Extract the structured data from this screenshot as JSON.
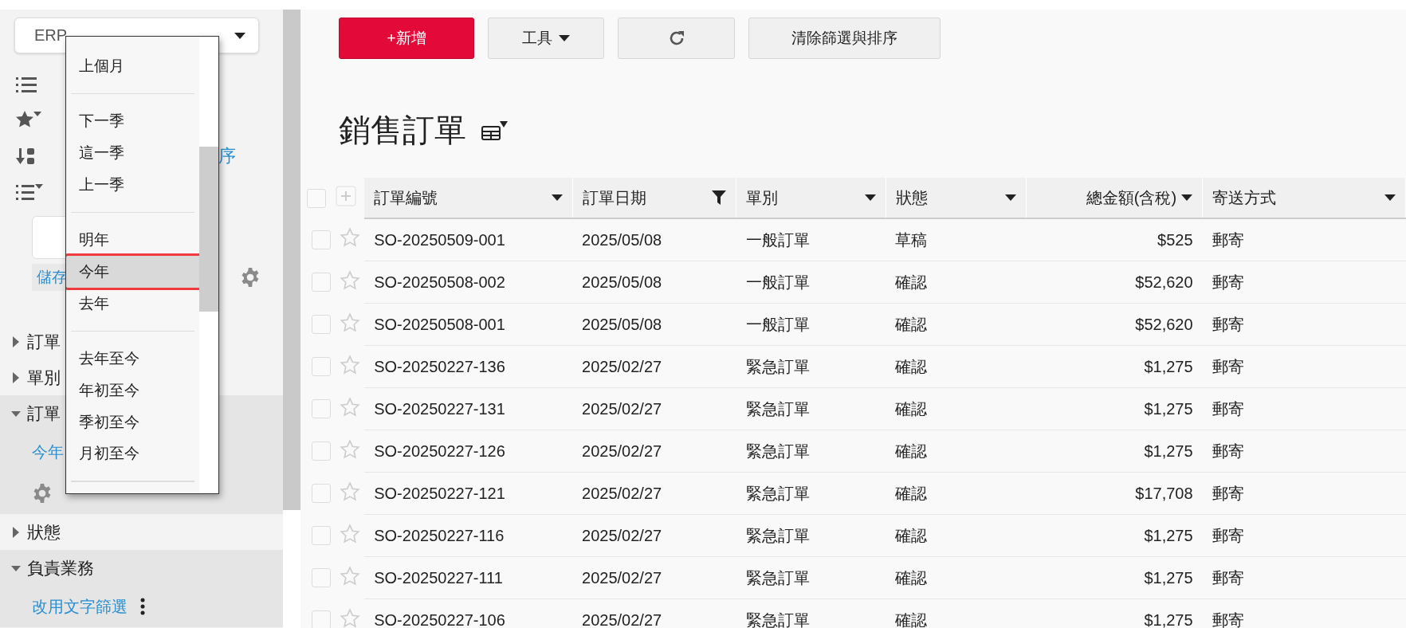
{
  "sidebar": {
    "view_select": {
      "value": "ERP"
    },
    "sort_row_text": "序",
    "save_link": "儲存",
    "sections": [
      {
        "label": "訂單",
        "expanded": false
      },
      {
        "label": "單別",
        "expanded": false
      },
      {
        "label": "訂單",
        "expanded": true,
        "children": [
          {
            "kind": "link",
            "label": "今年"
          },
          {
            "kind": "settings"
          }
        ]
      },
      {
        "label": "狀態",
        "expanded": false
      },
      {
        "label": "負責業務",
        "expanded": true,
        "children": [
          {
            "kind": "link_menu",
            "label": "改用文字篩選"
          }
        ]
      }
    ]
  },
  "dropdown": {
    "groups": [
      [
        {
          "label": "上個月",
          "selected": false
        }
      ],
      [
        {
          "label": "下一季",
          "selected": false
        },
        {
          "label": "這一季",
          "selected": false
        },
        {
          "label": "上一季",
          "selected": false
        }
      ],
      [
        {
          "label": "明年",
          "selected": false
        },
        {
          "label": "今年",
          "selected": true
        },
        {
          "label": "去年",
          "selected": false
        }
      ],
      [
        {
          "label": "去年至今",
          "selected": false
        },
        {
          "label": "年初至今",
          "selected": false
        },
        {
          "label": "季初至今",
          "selected": false
        },
        {
          "label": "月初至今",
          "selected": false
        }
      ]
    ]
  },
  "toolbar": {
    "buttons": [
      {
        "kind": "primary",
        "label": "+新增"
      },
      {
        "kind": "menu",
        "label": "工具"
      },
      {
        "kind": "refresh"
      },
      {
        "kind": "plain",
        "label": "清除篩選與排序"
      }
    ]
  },
  "title": "銷售訂單",
  "table": {
    "all_checked": false,
    "columns": [
      {
        "label": "訂單編號",
        "filtered": false,
        "kind": "text"
      },
      {
        "label": "訂單日期",
        "filtered": true,
        "kind": "text"
      },
      {
        "label": "單別",
        "filtered": false,
        "kind": "text"
      },
      {
        "label": "狀態",
        "filtered": false,
        "kind": "text"
      },
      {
        "label": "總金額(含稅)",
        "filtered": false,
        "kind": "amount"
      },
      {
        "label": "寄送方式",
        "filtered": false,
        "kind": "text"
      }
    ],
    "rows": [
      {
        "checked": false,
        "starred": false,
        "cells": [
          "SO-20250509-001",
          "2025/05/08",
          "一般訂單",
          "草稿",
          "$525",
          "郵寄"
        ]
      },
      {
        "checked": false,
        "starred": false,
        "cells": [
          "SO-20250508-002",
          "2025/05/08",
          "一般訂單",
          "確認",
          "$52,620",
          "郵寄"
        ]
      },
      {
        "checked": false,
        "starred": false,
        "cells": [
          "SO-20250508-001",
          "2025/05/08",
          "一般訂單",
          "確認",
          "$52,620",
          "郵寄"
        ]
      },
      {
        "checked": false,
        "starred": false,
        "cells": [
          "SO-20250227-136",
          "2025/02/27",
          "緊急訂單",
          "確認",
          "$1,275",
          "郵寄"
        ]
      },
      {
        "checked": false,
        "starred": false,
        "cells": [
          "SO-20250227-131",
          "2025/02/27",
          "緊急訂單",
          "確認",
          "$1,275",
          "郵寄"
        ]
      },
      {
        "checked": false,
        "starred": false,
        "cells": [
          "SO-20250227-126",
          "2025/02/27",
          "緊急訂單",
          "確認",
          "$1,275",
          "郵寄"
        ]
      },
      {
        "checked": false,
        "starred": false,
        "cells": [
          "SO-20250227-121",
          "2025/02/27",
          "緊急訂單",
          "確認",
          "$17,708",
          "郵寄"
        ]
      },
      {
        "checked": false,
        "starred": false,
        "cells": [
          "SO-20250227-116",
          "2025/02/27",
          "緊急訂單",
          "確認",
          "$1,275",
          "郵寄"
        ]
      },
      {
        "checked": false,
        "starred": false,
        "cells": [
          "SO-20250227-111",
          "2025/02/27",
          "緊急訂單",
          "確認",
          "$1,275",
          "郵寄"
        ]
      },
      {
        "checked": false,
        "starred": false,
        "cells": [
          "SO-20250227-106",
          "2025/02/27",
          "緊急訂單",
          "確認",
          "$1,275",
          "郵寄"
        ]
      }
    ]
  }
}
